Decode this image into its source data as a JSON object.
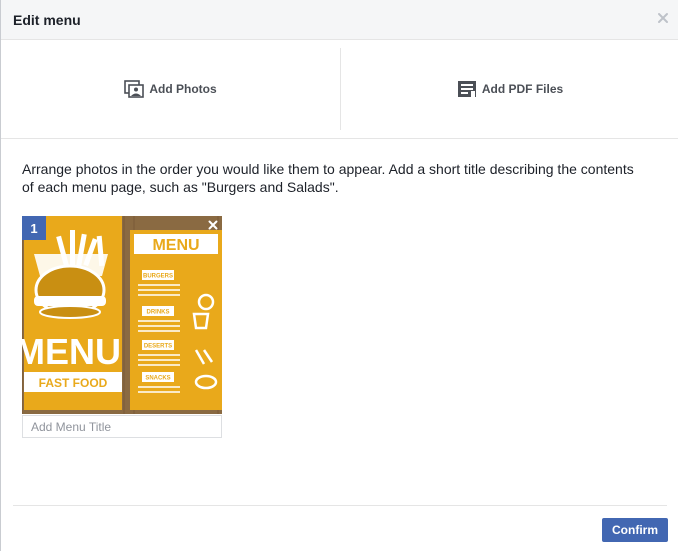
{
  "dialog": {
    "title": "Edit menu",
    "close_icon": "close-icon"
  },
  "add_options": {
    "photos_label": "Add Photos",
    "photos_icon": "photo-gallery-icon",
    "pdf_label": "Add PDF Files",
    "pdf_icon": "document-icon"
  },
  "instructions": "Arrange photos in the order you would like them to appear. Add a short title describing the contents of each menu page, such as \"Burgers and Salads\".",
  "menu_pages": [
    {
      "order": "1",
      "title_value": "",
      "title_placeholder": "Add Menu Title",
      "image": {
        "headline": "MENU",
        "subheadline": "FAST FOOD",
        "sections": [
          "BURGERS",
          "DRINKS",
          "DESERTS",
          "SNACKS"
        ]
      }
    }
  ],
  "footer": {
    "confirm_label": "Confirm"
  },
  "colors": {
    "accent": "#4267b2",
    "menu_yellow": "#e8a81a",
    "wood": "#8a6a42"
  }
}
